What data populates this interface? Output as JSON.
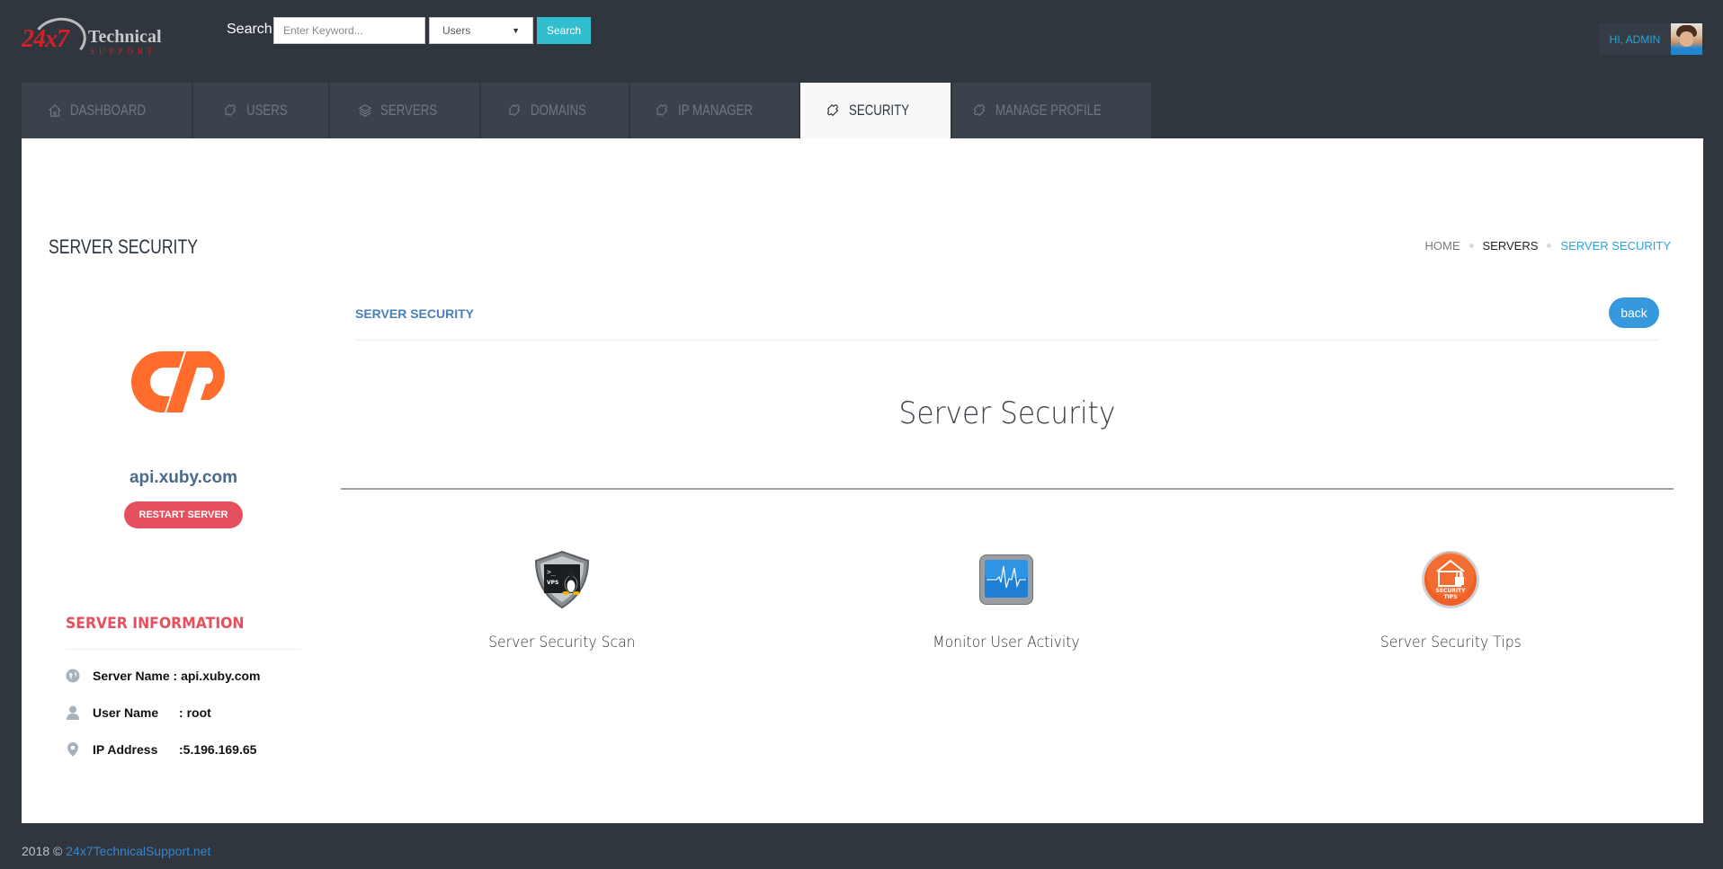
{
  "header": {
    "logo": {
      "primary": "24x7",
      "secondary": "Technical",
      "tertiary": "SUPPORT"
    },
    "search": {
      "label": "Search",
      "placeholder": "Enter Keyword...",
      "value": "",
      "select_value": "Users",
      "button_label": "Search"
    },
    "user": {
      "greeting": "HI, ADMIN"
    }
  },
  "nav": {
    "tabs": [
      {
        "label": "DASHBOARD",
        "icon": "home-icon",
        "active": false
      },
      {
        "label": "USERS",
        "icon": "puzzle-icon",
        "active": false
      },
      {
        "label": "SERVERS",
        "icon": "layers-icon",
        "active": false
      },
      {
        "label": "DOMAINS",
        "icon": "puzzle-icon",
        "active": false
      },
      {
        "label": "IP MANAGER",
        "icon": "puzzle-icon",
        "active": false
      },
      {
        "label": "SECURITY",
        "icon": "puzzle-icon",
        "active": true
      },
      {
        "label": "MANAGE PROFILE",
        "icon": "puzzle-icon",
        "active": false
      }
    ]
  },
  "page": {
    "title": "SERVER SECURITY",
    "breadcrumb": {
      "home": "HOME",
      "servers": "SERVERS",
      "current": "SERVER SECURITY"
    }
  },
  "sidebar": {
    "logo_icon": "cpanel-logo",
    "host": "api.xuby.com",
    "restart_label": "RESTART SERVER",
    "info_title": "SERVER INFORMATION",
    "info": [
      {
        "icon": "globe-icon",
        "label": "Server Name",
        "sep": " : ",
        "value": "api.xuby.com"
      },
      {
        "icon": "user-icon",
        "label": "User Name",
        "sep": "  : ",
        "value": "root"
      },
      {
        "icon": "map-pin-icon",
        "label": "IP Address",
        "sep": "  :",
        "value": "5.196.169.65"
      }
    ]
  },
  "main": {
    "section_label": "SERVER SECURITY",
    "back_label": "back",
    "heading": "Server Security",
    "features": [
      {
        "label": "Server Security Scan",
        "icon": "vps-shield-icon"
      },
      {
        "label": "Monitor User Activity",
        "icon": "monitor-pulse-icon"
      },
      {
        "label": "Server Security Tips",
        "icon": "security-tips-icon",
        "badge": [
          "SECURITY",
          "TIPS"
        ]
      }
    ]
  },
  "footer": {
    "year": "2018 ©",
    "link": "24x7TechnicalSupport.net"
  },
  "colors": {
    "background": "#2f363e",
    "tab": "#3a424c",
    "accent_blue": "#2ea3d7",
    "danger": "#e5505f",
    "search_button": "#31bfd0",
    "back_button": "#3799dd",
    "cpanel_orange": "#ff6c2c"
  }
}
